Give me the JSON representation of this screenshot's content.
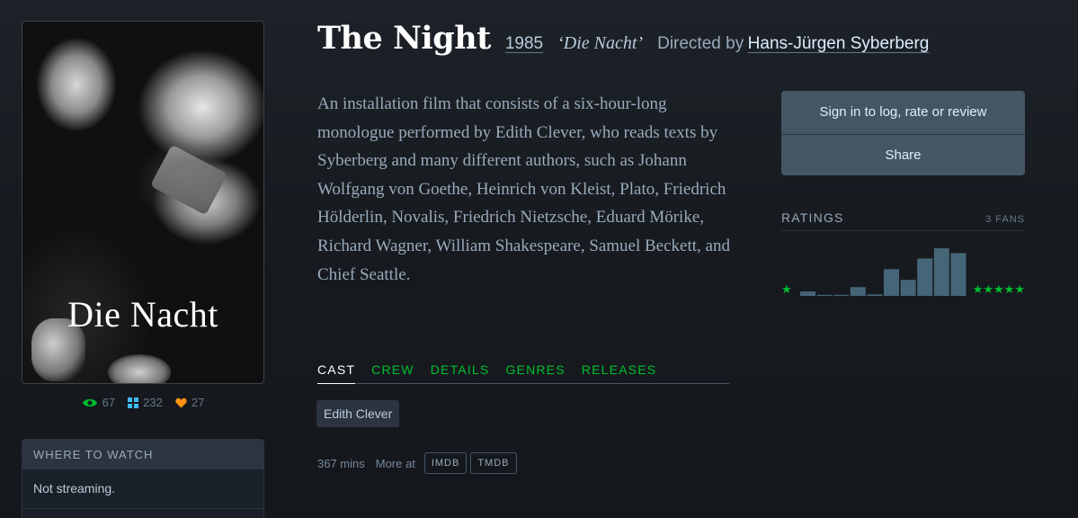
{
  "film": {
    "title": "The Night",
    "year": "1985",
    "original_title": "‘Die Nacht’",
    "directed_by_label": "Directed by",
    "director": "Hans-Jürgen Syberberg",
    "synopsis": "An installation film that consists of a six-hour-long monologue performed by Edith Clever, who reads texts by Syberberg and many different authors, such as Johann Wolfgang von Goethe, Heinrich von Kleist, Plato, Friedrich Hölderlin, Novalis, Friedrich Nietzsche, Eduard Mörike, Richard Wagner, William Shakespeare, Samuel Beckett, and Chief Seattle."
  },
  "poster": {
    "title_text": "Die Nacht"
  },
  "stats": {
    "watches": "67",
    "lists": "232",
    "likes": "27"
  },
  "where_to_watch": {
    "header": "WHERE TO WATCH",
    "status": "Not streaming."
  },
  "tabs": [
    {
      "label": "CAST",
      "active": true
    },
    {
      "label": "CREW"
    },
    {
      "label": "DETAILS"
    },
    {
      "label": "GENRES"
    },
    {
      "label": "RELEASES"
    }
  ],
  "cast": [
    "Edith Clever"
  ],
  "meta": {
    "runtime": "367 mins",
    "more_at": "More at",
    "links": [
      "IMDB",
      "TMDB"
    ]
  },
  "actions": {
    "sign_in": "Sign in to log, rate or review",
    "share": "Share"
  },
  "ratings": {
    "title": "RATINGS",
    "fans": "3 FANS",
    "star_low": "★",
    "star_high": "★★★★★",
    "histogram": [
      0.09,
      0.02,
      0.02,
      0.18,
      0.03,
      0.55,
      0.33,
      0.77,
      0.98,
      0.88
    ]
  },
  "colors": {
    "background": "#14181c",
    "accent_green": "#00c030",
    "bar": "#456677",
    "eye_icon": "#00c030",
    "list_icon": "#40bcf4",
    "heart_icon": "#ff9010"
  }
}
